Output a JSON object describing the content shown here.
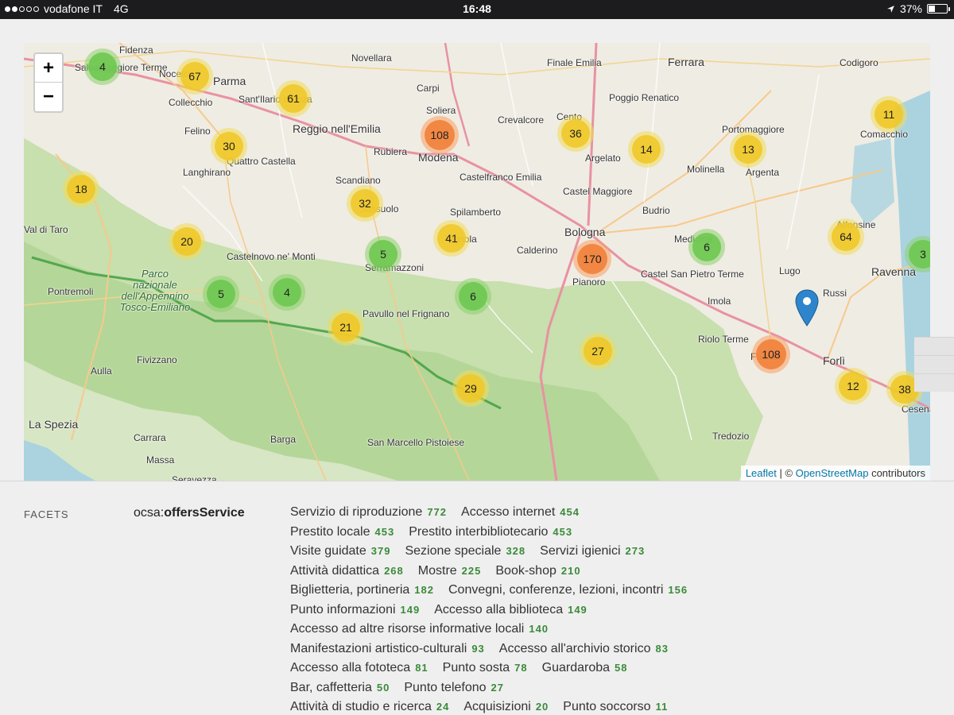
{
  "statusbar": {
    "carrier": "vodafone IT",
    "network": "4G",
    "time": "16:48",
    "battery": "37%",
    "battery_level": 0.37,
    "signal_bars": 2,
    "icons": [
      "signal-icon",
      "location-arrow-icon",
      "battery-icon"
    ]
  },
  "map": {
    "zoom_in": "+",
    "zoom_out": "−",
    "attribution": {
      "leaflet": "Leaflet",
      "sep": " | © ",
      "osm": "OpenStreetMap",
      "suffix": " contributors"
    },
    "places": [
      "Fidenza",
      "Salsomaggiore Terme",
      "Noceto",
      "Parma",
      "Sant'Ilario d'Enza",
      "Novellara",
      "Carpi",
      "Soliera",
      "Finale Emilia",
      "Ferrara",
      "Codigoro",
      "Collecchio",
      "Reggio nell'Emilia",
      "Rubiera",
      "Modena",
      "Crevalcore",
      "Cento",
      "Poggio Renatico",
      "Portomaggiore",
      "Comacchio",
      "Felino",
      "Quattro Castella",
      "Scandiano",
      "Castelfranco Emilia",
      "Argelato",
      "Molinella",
      "Argenta",
      "Langhirano",
      "Castel Maggiore",
      "Budrio",
      "Sassuolo",
      "Spilamberto",
      "Vignola",
      "Bologna",
      "Medicina",
      "Alfonsine",
      "Castelnovo ne' Monti",
      "Serramazzoni",
      "Calderino",
      "Pianoro",
      "Castel San Pietro Terme",
      "Lugo",
      "Russi",
      "Ravenna",
      "Pontremoli",
      "Parco nazionale dell'Appennino Tosco-Emiliano",
      "Pavullo nel Frignano",
      "Imola",
      "Faenza",
      "Riolo Terme",
      "Forlì",
      "Aulla",
      "Fivizzano",
      "Cesena",
      "La Spezia",
      "Carrara",
      "Barga",
      "San Marcello Pistoiese",
      "Tredozio",
      "Massa",
      "Seravezza",
      "Val di Taro"
    ],
    "clusters": [
      {
        "count": "4",
        "level": "green"
      },
      {
        "count": "67",
        "level": "yellow"
      },
      {
        "count": "61",
        "level": "yellow"
      },
      {
        "count": "108",
        "level": "orange"
      },
      {
        "count": "36",
        "level": "yellow"
      },
      {
        "count": "14",
        "level": "yellow"
      },
      {
        "count": "13",
        "level": "yellow"
      },
      {
        "count": "11",
        "level": "yellow"
      },
      {
        "count": "30",
        "level": "yellow"
      },
      {
        "count": "18",
        "level": "yellow"
      },
      {
        "count": "32",
        "level": "yellow"
      },
      {
        "count": "20",
        "level": "yellow"
      },
      {
        "count": "5",
        "level": "green"
      },
      {
        "count": "41",
        "level": "yellow"
      },
      {
        "count": "170",
        "level": "orange"
      },
      {
        "count": "6",
        "level": "green"
      },
      {
        "count": "64",
        "level": "yellow"
      },
      {
        "count": "3",
        "level": "green"
      },
      {
        "count": "5",
        "level": "green"
      },
      {
        "count": "4",
        "level": "green"
      },
      {
        "count": "6",
        "level": "green"
      },
      {
        "count": "21",
        "level": "yellow"
      },
      {
        "count": "27",
        "level": "yellow"
      },
      {
        "count": "108",
        "level": "orange"
      },
      {
        "count": "12",
        "level": "yellow"
      },
      {
        "count": "38",
        "level": "yellow"
      },
      {
        "count": "29",
        "level": "yellow"
      }
    ]
  },
  "facets": {
    "label": "FACETS",
    "key_prefix": "ocsa:",
    "key_name": "offersService",
    "lines": [
      [
        {
          "name": "Servizio di riproduzione",
          "count": "772"
        },
        {
          "name": "Accesso internet",
          "count": "454"
        }
      ],
      [
        {
          "name": "Prestito locale",
          "count": "453"
        },
        {
          "name": "Prestito interbibliotecario",
          "count": "453"
        }
      ],
      [
        {
          "name": "Visite guidate",
          "count": "379"
        },
        {
          "name": "Sezione speciale",
          "count": "328"
        },
        {
          "name": "Servizi igienici",
          "count": "273"
        }
      ],
      [
        {
          "name": "Attività didattica",
          "count": "268"
        },
        {
          "name": "Mostre",
          "count": "225"
        },
        {
          "name": "Book-shop",
          "count": "210"
        }
      ],
      [
        {
          "name": "Biglietteria, portineria",
          "count": "182"
        },
        {
          "name": "Convegni, conferenze, lezioni, incontri",
          "count": "156"
        }
      ],
      [
        {
          "name": "Punto informazioni",
          "count": "149"
        },
        {
          "name": "Accesso alla biblioteca",
          "count": "149"
        }
      ],
      [
        {
          "name": "Accesso ad altre risorse informative locali",
          "count": "140"
        }
      ],
      [
        {
          "name": "Manifestazioni artistico-culturali",
          "count": "93"
        },
        {
          "name": "Accesso all'archivio storico",
          "count": "83"
        }
      ],
      [
        {
          "name": "Accesso alla fototeca",
          "count": "81"
        },
        {
          "name": "Punto sosta",
          "count": "78"
        },
        {
          "name": "Guardaroba",
          "count": "58"
        }
      ],
      [
        {
          "name": "Bar, caffetteria",
          "count": "50"
        },
        {
          "name": "Punto telefono",
          "count": "27"
        }
      ],
      [
        {
          "name": "Attività di studio e ricerca",
          "count": "24"
        },
        {
          "name": "Acquisizioni",
          "count": "20"
        },
        {
          "name": "Punto soccorso",
          "count": "11"
        }
      ]
    ]
  }
}
